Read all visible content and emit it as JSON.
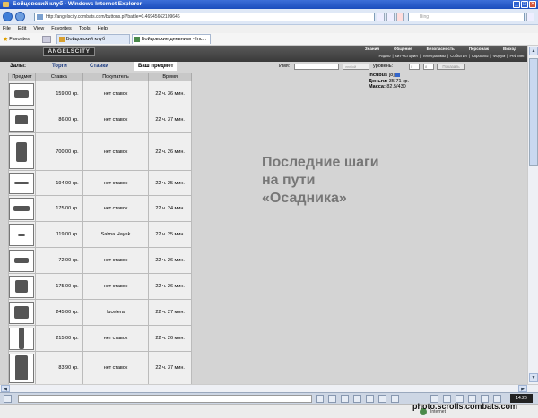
{
  "window": {
    "title": "Бойцовский клуб - Windows Internet Explorer"
  },
  "address": {
    "url": "http://angelscity.combats.com/buttons.pl?battle=0.46945662109646",
    "search_placeholder": "Bing"
  },
  "menu": [
    "File",
    "Edit",
    "View",
    "Favorites",
    "Tools",
    "Help"
  ],
  "favbar": {
    "favorites_label": "Favorites",
    "tabs": [
      "Бойцовский клуб",
      "Бойцовские дневники - Inc..."
    ]
  },
  "game": {
    "logo": "ANGELSCITY",
    "top_menu": [
      "Знания",
      "Общение",
      "Безопасность",
      "Персонаж",
      "Выход"
    ],
    "top_submenu": [
      "Радио",
      "|",
      "хит-история",
      "|",
      "Телеграммы",
      "|",
      "События",
      "|",
      "Скроллы",
      "|",
      "Форум",
      "|",
      "Рейтинг"
    ],
    "subnav": {
      "halls_label": "Залы:",
      "tab_trade": "Торги",
      "tab_bids": "Ставки",
      "tab_current": "Ваш предмет"
    },
    "filter": {
      "name_label": "Имя:",
      "level_label": "уровень:",
      "select_value": "любой",
      "level_from": "0",
      "level_to": "8",
      "show_button": "Показать"
    },
    "table": {
      "headers": [
        "Предмет",
        "Ставка",
        "Покупатель",
        "Время"
      ],
      "rows": [
        {
          "bid": "159.00 кр.",
          "buyer": "нет ставок",
          "time": "22 ч. 36 мин.",
          "h": 29
        },
        {
          "bid": "86.00 кр.",
          "buyer": "нет ставок",
          "time": "22 ч. 37 мин.",
          "h": 29
        },
        {
          "bid": "700.00 кр.",
          "buyer": "нет ставок",
          "time": "22 ч. 26 мин.",
          "h": 42
        },
        {
          "bid": "194.00 кр.",
          "buyer": "нет ставок",
          "time": "22 ч. 25 мин.",
          "h": 28
        },
        {
          "bid": "175.00 кр.",
          "buyer": "нет ставок",
          "time": "22 ч. 24 мин.",
          "h": 29
        },
        {
          "bid": "119.00 кр.",
          "buyer": "Salma Hayek",
          "time": "22 ч. 25 мин.",
          "h": 29
        },
        {
          "bid": "72.00 кр.",
          "buyer": "нет ставок",
          "time": "22 ч. 26 мин.",
          "h": 29
        },
        {
          "bid": "175.00 кр.",
          "buyer": "нет ставок",
          "time": "22 ч. 26 мин.",
          "h": 29
        },
        {
          "bid": "245.00 кр.",
          "buyer": "lucefera",
          "time": "22 ч. 27 мин.",
          "h": 29
        },
        {
          "bid": "215.00 кр.",
          "buyer": "нет ставок",
          "time": "22 ч. 26 мин.",
          "h": 29
        },
        {
          "bid": "83.90 кр.",
          "buyer": "нет ставок",
          "time": "22 ч. 37 мин.",
          "h": 37
        }
      ]
    },
    "player": {
      "name": "Incubus",
      "level": "[8]",
      "money_label": "Деньги:",
      "money": "35.71 кр.",
      "mass_label": "Масса:",
      "mass": "82.5/430"
    },
    "overlay": {
      "line1": "Последние шаги",
      "line2": "на пути",
      "line3": "«Осадника»"
    }
  },
  "taskbar": {
    "clock": "14:26"
  },
  "status": {
    "done": "Internet"
  },
  "watermark": "photo.scrolls.combats.com",
  "colors": {
    "title_blue": "#2456c8",
    "game_bg": "#d4d4d4",
    "link_blue": "#1a3a80",
    "overlay_gray": "#777777"
  }
}
